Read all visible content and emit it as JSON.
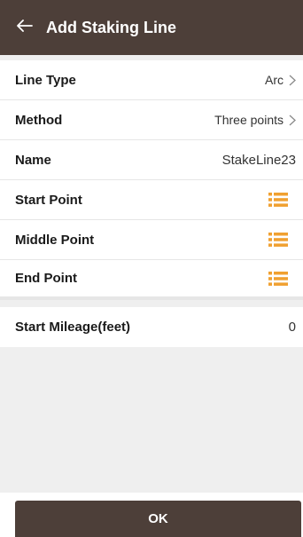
{
  "header": {
    "title": "Add Staking Line",
    "back_icon": "arrow-left-icon",
    "background": "#4d3f39"
  },
  "rows": {
    "line_type": {
      "label": "Line Type",
      "value": "Arc",
      "icon": "chevron-right-icon"
    },
    "method": {
      "label": "Method",
      "value": "Three points",
      "icon": "chevron-right-icon"
    },
    "name": {
      "label": "Name",
      "value": "StakeLine23"
    },
    "start_point": {
      "label": "Start Point",
      "icon": "point-list-icon"
    },
    "middle_point": {
      "label": "Middle Point",
      "icon": "point-list-icon"
    },
    "end_point": {
      "label": "End Point",
      "icon": "point-list-icon"
    },
    "start_mileage": {
      "label": "Start Mileage(feet)",
      "value": "0"
    }
  },
  "footer": {
    "ok_label": "OK"
  },
  "colors": {
    "accent": "#f0a030",
    "appbar": "#4d3f39",
    "background": "#efefef"
  }
}
